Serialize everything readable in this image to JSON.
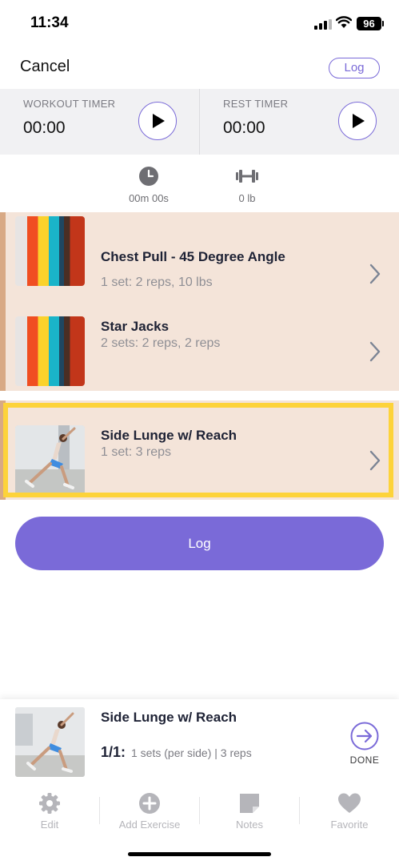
{
  "status_bar": {
    "time": "11:34",
    "battery": "96"
  },
  "header": {
    "cancel_label": "Cancel",
    "log_label": "Log"
  },
  "timers": {
    "workout": {
      "label": "WORKOUT TIMER",
      "value": "00:00"
    },
    "rest": {
      "label": "REST TIMER",
      "value": "00:00"
    }
  },
  "stats": {
    "duration": "00m 00s",
    "weight": "0 lb"
  },
  "exercises": [
    {
      "name": "Chest Pull - 45 Degree Angle",
      "detail": "1 set: 2 reps, 10 lbs"
    },
    {
      "name": "Star Jacks",
      "detail": "2 sets: 2 reps, 2 reps"
    },
    {
      "name": "Side Lunge w/ Reach",
      "detail": "1 set: 3 reps"
    }
  ],
  "log_button_label": "Log",
  "current": {
    "name": "Side Lunge w/ Reach",
    "set_index": "1/1:",
    "set_detail": "1 sets (per side) | 3 reps",
    "done_label": "DONE"
  },
  "toolbar": {
    "edit": "Edit",
    "add_exercise": "Add Exercise",
    "notes": "Notes",
    "favorite": "Favorite"
  },
  "colors": {
    "accent": "#7a6ad8",
    "group_bg": "#f4e4d9",
    "group_bar": "#d8a985",
    "highlight": "#fdd33a",
    "timer_bg": "#f1f1f3"
  },
  "icons": [
    "play-icon",
    "clock-icon",
    "dumbbell-icon",
    "chevron-right-icon",
    "arrow-circle-right-icon",
    "gear-icon",
    "plus-circle-icon",
    "note-icon",
    "heart-icon"
  ]
}
